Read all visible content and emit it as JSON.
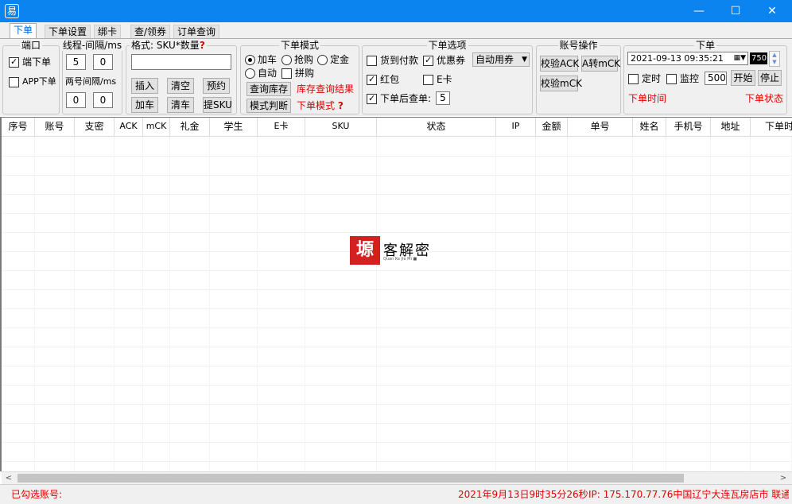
{
  "window": {
    "title": "",
    "app_icon": "易",
    "minimize_glyph": "—",
    "maximize_glyph": "☐",
    "close_glyph": "✕"
  },
  "tabs": [
    {
      "label": "下单",
      "active": true
    },
    {
      "label": "下单设置"
    },
    {
      "label": "绑卡"
    },
    {
      "label": "查/领券"
    },
    {
      "label": "订单查询"
    }
  ],
  "groups": {
    "port": {
      "title": "端口",
      "pc_label": "端下单",
      "pc_checked": true,
      "app_label": "APP下单",
      "app_checked": false
    },
    "thread": {
      "title": "线程-间隔/ms",
      "threads": "5",
      "interval": "0",
      "label2": "两号间隔/ms",
      "val3": "0",
      "val4": "0"
    },
    "sku": {
      "title": "格式: SKU*数量",
      "help_glyph": "?",
      "input_value": "",
      "insert": "插入",
      "clear": "清空",
      "reserve": "预约",
      "add_cart": "加车",
      "clear_cart": "清车",
      "extract_sku": "提SKU"
    },
    "mode": {
      "title": "下单模式",
      "add_cart": "加车",
      "snap": "抢购",
      "deposit": "定金",
      "auto": "自动",
      "group_buy": "拼购",
      "query_stock": "查询库存",
      "stock_result": "库存查询结果",
      "judge_mode": "模式判断",
      "order_mode": "下单模式",
      "help_glyph": "?"
    },
    "options": {
      "title": "下单选项",
      "cod": "货到付款",
      "coupon": "优惠券",
      "coupon_select": "自动用券",
      "redpacket": "红包",
      "ecard": "E卡",
      "check_after": "下单后查单:",
      "check_after_value": "5"
    },
    "account": {
      "title": "账号操作",
      "verify_ack": "校验ACK",
      "a_to_mck": "A转mCK",
      "verify_mck": "校验mCK"
    },
    "order": {
      "title": "下单",
      "datetime": "2021-09-13 09:35:21",
      "spin_value": "750",
      "timer": "定时",
      "monitor": "监控",
      "monitor_value": "500",
      "start": "开始",
      "stop": "停止",
      "order_time": "下单时间",
      "order_status": "下单状态"
    }
  },
  "table": {
    "columns": [
      "序号",
      "账号",
      "支密",
      "ACK",
      "mCK",
      "礼金",
      "学生",
      "E卡",
      "SKU",
      "状态",
      "IP",
      "金额",
      "单号",
      "姓名",
      "手机号",
      "地址",
      "下单时"
    ]
  },
  "watermark": {
    "mark": "塬",
    "text": "客解密",
    "sub": "Quan Ke Jie Mi ■"
  },
  "status": {
    "selected_accounts": "已勾选账号:",
    "datetime": "2021年9月13日9时35分26秒",
    "ip": "IP: 175.170.77.76中国辽宁大连瓦房店市 联通"
  },
  "colors": {
    "titlebar": "#0b84f0",
    "accent_red": "#e00000",
    "tab_active": "#0066cc"
  }
}
